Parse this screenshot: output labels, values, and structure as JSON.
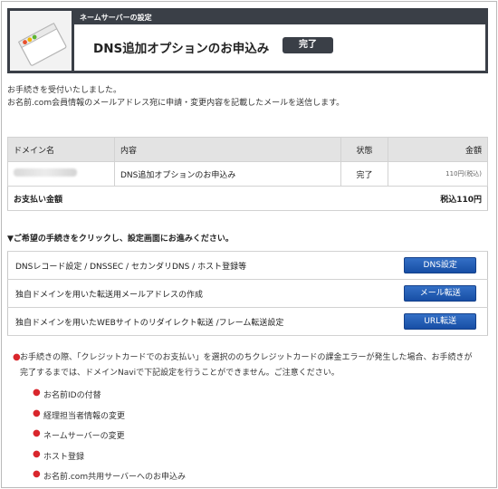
{
  "header": {
    "bar_label": "ネームサーバーの設定",
    "title": "DNS追加オプションのお申込み",
    "badge": "完了"
  },
  "messages": [
    "お手続きを受付いたしました。",
    "お名前.com会員情報のメールアドレス宛に申請・変更内容を記載したメールを送信します。"
  ],
  "order_table": {
    "headers": [
      "ドメイン名",
      "内容",
      "状態",
      "金額"
    ],
    "row": {
      "domain": "",
      "content": "DNS追加オプションのお申込み",
      "status": "完了",
      "amount": "110円(税込)"
    },
    "total_label": "お支払い金額",
    "total_value": "税込110円"
  },
  "section_title": "▼ご希望の手続きをクリックし、設定画面にお進みください。",
  "actions": [
    {
      "label": "DNSレコード設定 / DNSSEC / セカンダリDNS / ホスト登録等",
      "button": "DNS設定"
    },
    {
      "label": "独自ドメインを用いた転送用メールアドレスの作成",
      "button": "メール転送"
    },
    {
      "label": "独自ドメインを用いたWEBサイトのリダイレクト転送 /フレーム転送設定",
      "button": "URL転送"
    }
  ],
  "notes": {
    "main": "お手続きの際、「クレジットカードでのお支払い」を選択ののちクレジットカードの課金エラーが発生した場合、お手続きが完了するまでは、ドメインNaviで下記設定を行うことができません。ご注意ください。",
    "items": [
      "お名前IDの付替",
      "経理担当者情報の変更",
      "ネームサーバーの変更",
      "ホスト登録",
      "お名前.com共用サーバーへのお申込み"
    ]
  },
  "colors": {
    "accent_dark": "#3a3f47",
    "button_blue": "#1f58b4",
    "bullet_red": "#d9262c"
  }
}
